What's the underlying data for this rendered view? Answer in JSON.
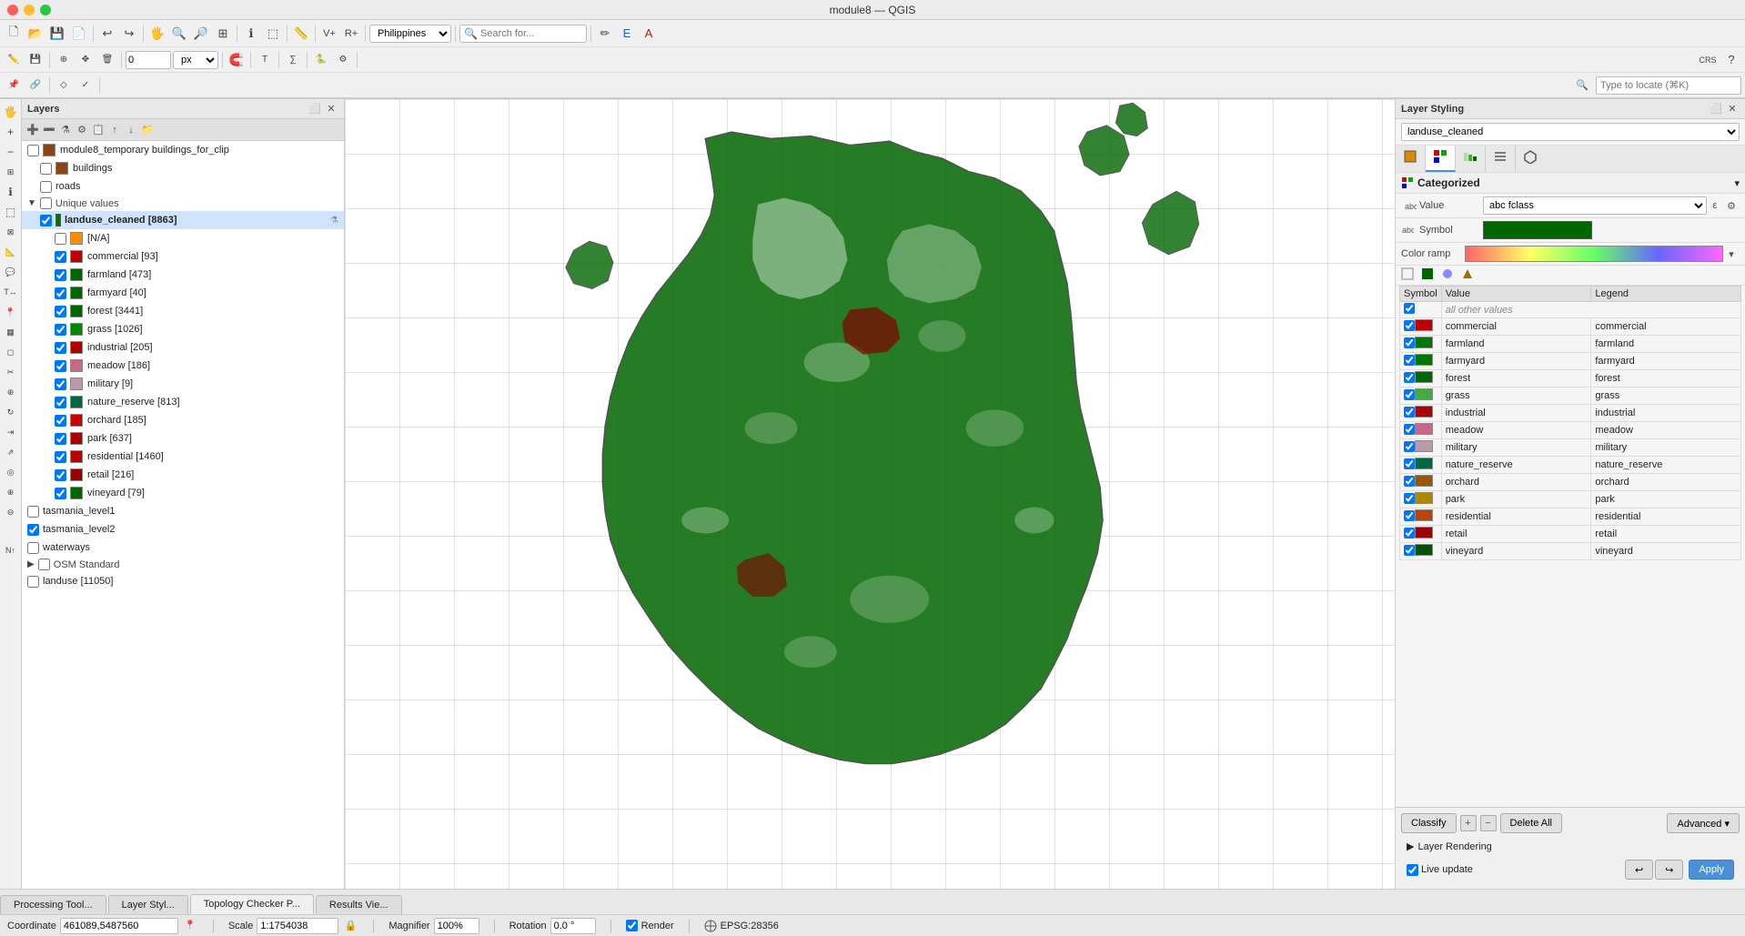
{
  "window": {
    "title": "module8 — QGIS"
  },
  "toolbar1": {
    "icons": [
      "📁",
      "💾",
      "🖨",
      "✂",
      "📋",
      "↩",
      "↪",
      "🔍",
      "🔎",
      "🖐",
      "➕",
      "✏",
      "📐",
      "📏",
      "🗑",
      "⚙"
    ],
    "location_combo": "Philippines",
    "search_placeholder": "Search for...",
    "search_value": ""
  },
  "layers_panel": {
    "title": "Layers",
    "items": [
      {
        "id": "module8_temp",
        "name": "module8_temporary buildings_for_clip",
        "checked": false,
        "color": "#8B4513",
        "indent": 0,
        "type": "vector"
      },
      {
        "id": "buildings",
        "name": "buildings",
        "checked": false,
        "color": "#8B4513",
        "indent": 1,
        "type": "vector"
      },
      {
        "id": "roads",
        "name": "roads",
        "checked": false,
        "color": null,
        "indent": 1,
        "type": "vector"
      },
      {
        "id": "unique_values_group",
        "name": "Unique values",
        "checked": false,
        "color": null,
        "indent": 0,
        "type": "group"
      },
      {
        "id": "landuse_cleaned",
        "name": "landuse_cleaned [8863]",
        "checked": true,
        "color": "#006600",
        "indent": 1,
        "type": "vector",
        "active": true
      },
      {
        "id": "na",
        "name": "[N/A]",
        "checked": false,
        "color": "#FF8C00",
        "indent": 2,
        "type": "item"
      },
      {
        "id": "commercial",
        "name": "commercial [93]",
        "checked": true,
        "color": "#C00000",
        "indent": 2,
        "type": "item"
      },
      {
        "id": "farmland",
        "name": "farmland [473]",
        "checked": true,
        "color": "#006600",
        "indent": 2,
        "type": "item"
      },
      {
        "id": "farmyard",
        "name": "farmyard [40]",
        "checked": true,
        "color": "#006600",
        "indent": 2,
        "type": "item"
      },
      {
        "id": "forest",
        "name": "forest [3441]",
        "checked": true,
        "color": "#006600",
        "indent": 2,
        "type": "item"
      },
      {
        "id": "grass",
        "name": "grass [1026]",
        "checked": true,
        "color": "#008800",
        "indent": 2,
        "type": "item"
      },
      {
        "id": "industrial",
        "name": "industrial [205]",
        "checked": true,
        "color": "#B00000",
        "indent": 2,
        "type": "item"
      },
      {
        "id": "meadow",
        "name": "meadow [186]",
        "checked": true,
        "color": "#CC0066",
        "indent": 2,
        "type": "item"
      },
      {
        "id": "military",
        "name": "military [9]",
        "checked": true,
        "color": "#BB99AA",
        "indent": 2,
        "type": "item"
      },
      {
        "id": "nature_reserve",
        "name": "nature_reserve [813]",
        "checked": true,
        "color": "#006644",
        "indent": 2,
        "type": "item"
      },
      {
        "id": "orchard",
        "name": "orchard [185]",
        "checked": true,
        "color": "#CC0000",
        "indent": 2,
        "type": "item"
      },
      {
        "id": "park",
        "name": "park [637]",
        "checked": true,
        "color": "#AA0000",
        "indent": 2,
        "type": "item"
      },
      {
        "id": "residential",
        "name": "residential [1460]",
        "checked": true,
        "color": "#BB0000",
        "indent": 2,
        "type": "item"
      },
      {
        "id": "retail",
        "name": "retail [216]",
        "checked": true,
        "color": "#990000",
        "indent": 2,
        "type": "item"
      },
      {
        "id": "vineyard",
        "name": "vineyard [79]",
        "checked": true,
        "color": "#006600",
        "indent": 2,
        "type": "item"
      },
      {
        "id": "tasmania_level1",
        "name": "tasmania_level1",
        "checked": false,
        "color": null,
        "indent": 0,
        "type": "vector"
      },
      {
        "id": "tasmania_level2",
        "name": "tasmania_level2",
        "checked": true,
        "color": null,
        "indent": 0,
        "type": "vector"
      },
      {
        "id": "waterways",
        "name": "waterways",
        "checked": false,
        "color": null,
        "indent": 0,
        "type": "vector"
      },
      {
        "id": "osm_standard",
        "name": "OSM Standard",
        "checked": false,
        "color": null,
        "indent": 0,
        "type": "raster_group"
      },
      {
        "id": "landuse",
        "name": "landuse [11050]",
        "checked": false,
        "color": null,
        "indent": 0,
        "type": "vector"
      }
    ]
  },
  "styling_panel": {
    "title": "Layer Styling",
    "layer_combo": "landuse_cleaned",
    "style_type": "Categorized",
    "value_field": "fclass",
    "symbol_color": "#006600",
    "color_ramp": "Random colors",
    "columns": [
      "Symbol",
      "Value",
      "Legend"
    ],
    "all_other_label": "all other values",
    "rows": [
      {
        "checked": true,
        "color": "#FF8C00",
        "value": "all other values",
        "legend": "",
        "is_other": true
      },
      {
        "checked": true,
        "color": "#C00000",
        "value": "commercial",
        "legend": "commercial"
      },
      {
        "checked": true,
        "color": "#007700",
        "value": "farmland",
        "legend": "farmland"
      },
      {
        "checked": true,
        "color": "#007700",
        "value": "farmyard",
        "legend": "farmyard"
      },
      {
        "checked": true,
        "color": "#007700",
        "value": "forest",
        "legend": "forest"
      },
      {
        "checked": true,
        "color": "#44AA44",
        "value": "grass",
        "legend": "grass"
      },
      {
        "checked": true,
        "color": "#B00000",
        "value": "industrial",
        "legend": "industrial"
      },
      {
        "checked": true,
        "color": "#CC6688",
        "value": "meadow",
        "legend": "meadow"
      },
      {
        "checked": true,
        "color": "#9988AA",
        "value": "military",
        "legend": "military"
      },
      {
        "checked": true,
        "color": "#006644",
        "value": "nature_reserve",
        "legend": "nature_reserve"
      },
      {
        "checked": true,
        "color": "#995500",
        "value": "orchard",
        "legend": "orchard"
      },
      {
        "checked": true,
        "color": "#AA8800",
        "value": "park",
        "legend": "park"
      },
      {
        "checked": true,
        "color": "#BB4400",
        "value": "residential",
        "legend": "residential"
      },
      {
        "checked": true,
        "color": "#990000",
        "value": "retail",
        "legend": "retail"
      },
      {
        "checked": true,
        "color": "#005500",
        "value": "vineyard",
        "legend": "vineyard"
      }
    ],
    "classify_btn": "Classify",
    "delete_all_btn": "Delete All",
    "advanced_btn": "Advanced ▾",
    "layer_rendering_label": "Layer Rendering",
    "live_update_label": "Live update",
    "render_btn": "Render",
    "apply_btn": "Apply"
  },
  "bottom_tabs": [
    {
      "id": "processing",
      "label": "Processing Tool...",
      "active": false
    },
    {
      "id": "layer_style",
      "label": "Layer Styl...",
      "active": false
    },
    {
      "id": "topology",
      "label": "Topology Checker P...",
      "active": false
    },
    {
      "id": "results",
      "label": "Results Vie...",
      "active": false
    }
  ],
  "status_bar": {
    "coordinate_label": "Coordinate",
    "coordinate_value": "461089,5487560",
    "scale_label": "Scale",
    "scale_value": "1:1754038",
    "magnifier_label": "Magnifier",
    "magnifier_value": "100%",
    "rotation_label": "Rotation",
    "rotation_value": "0.0 °",
    "render_label": "Render",
    "epsg_value": "EPSG:28356"
  },
  "locate_placeholder": "Type to locate (⌘K)"
}
